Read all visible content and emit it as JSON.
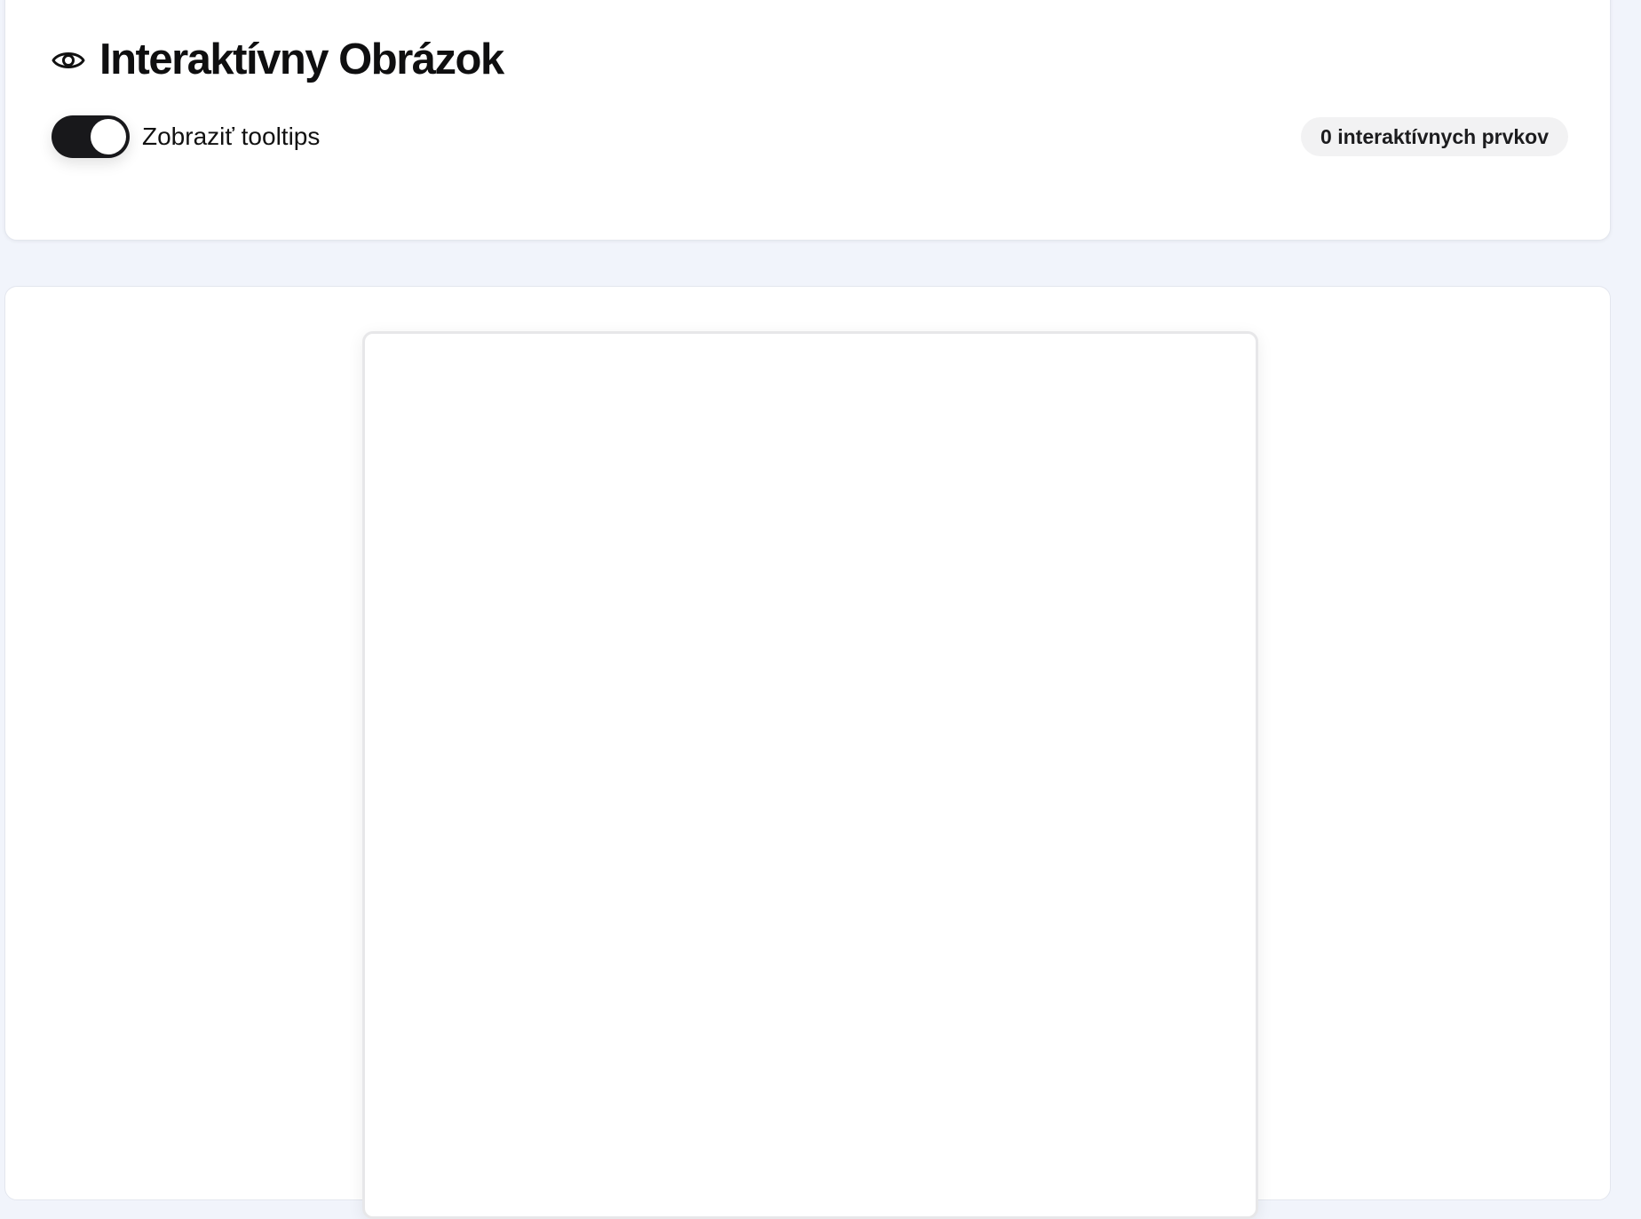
{
  "header": {
    "title": "Interaktívny Obrázok",
    "icon": "eye-icon",
    "tooltip_toggle": {
      "label": "Zobraziť tooltips",
      "enabled": true
    },
    "count_badge": "0 interaktívnych prvkov"
  },
  "colors": {
    "page_background": "#f1f4fb",
    "toggle_on": "#18181b",
    "badge_background": "#f2f2f3"
  },
  "image_viewer": {
    "interactive_items": []
  }
}
